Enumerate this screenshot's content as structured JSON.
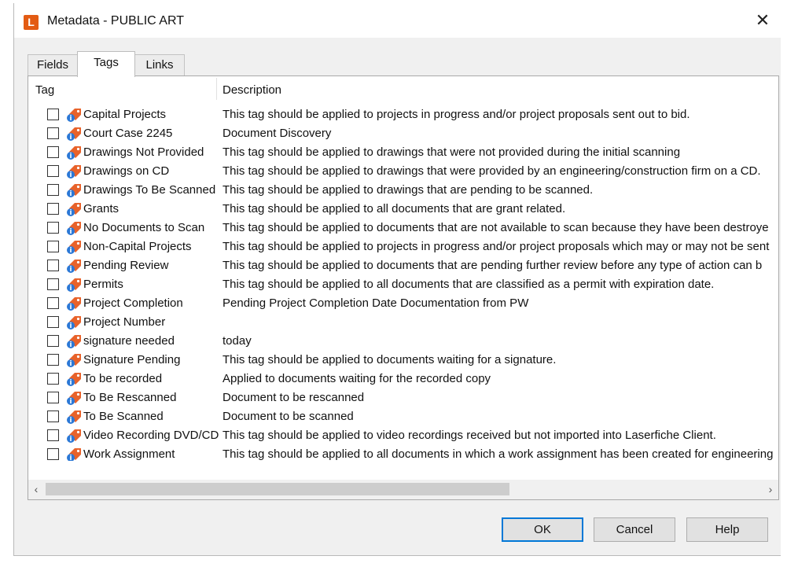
{
  "window": {
    "logo_letter": "L",
    "title": "Metadata - PUBLIC ART",
    "close_glyph": "✕"
  },
  "tabs": [
    {
      "label": "Fields",
      "active": false
    },
    {
      "label": "Tags",
      "active": true
    },
    {
      "label": "Links",
      "active": false
    }
  ],
  "columns": {
    "tag": "Tag",
    "description": "Description"
  },
  "tags": [
    {
      "name": "Capital Projects",
      "description": "This tag should be applied to projects in progress and/or project proposals sent out to bid.",
      "checked": false
    },
    {
      "name": "Court Case 2245",
      "description": "Document Discovery",
      "checked": false
    },
    {
      "name": "Drawings Not Provided",
      "description": "This tag should be applied to drawings that were not provided during the initial scanning",
      "checked": false
    },
    {
      "name": "Drawings on CD",
      "description": "This tag should be applied to drawings that were provided by an engineering/construction firm on a CD.",
      "checked": false
    },
    {
      "name": "Drawings To Be Scanned",
      "description": "This tag should be applied to drawings that are pending to be scanned.",
      "checked": false
    },
    {
      "name": "Grants",
      "description": "This tag should be applied to all documents that are grant related.",
      "checked": false
    },
    {
      "name": "No Documents to Scan",
      "description": "This tag should be applied to documents that are not available to scan because they have been destroye",
      "checked": false
    },
    {
      "name": "Non-Capital Projects",
      "description": "This tag should be applied to projects in progress and/or project proposals which may or may not be sent",
      "checked": false
    },
    {
      "name": "Pending Review",
      "description": "This tag should be applied to documents that are pending further review before any type of action can b",
      "checked": false
    },
    {
      "name": "Permits",
      "description": "This tag should be applied to all documents that are classified as a permit with expiration date.",
      "checked": false
    },
    {
      "name": "Project Completion",
      "description": "Pending Project Completion Date Documentation from PW",
      "checked": false
    },
    {
      "name": "Project Number",
      "description": "",
      "checked": false
    },
    {
      "name": "signature needed",
      "description": "today",
      "checked": false
    },
    {
      "name": "Signature Pending",
      "description": "This tag should be applied to documents waiting for a signature.",
      "checked": false
    },
    {
      "name": "To be recorded",
      "description": "Applied to documents waiting for the recorded copy",
      "checked": false
    },
    {
      "name": "To Be Rescanned",
      "description": "Document to be rescanned",
      "checked": false
    },
    {
      "name": "To Be Scanned",
      "description": "Document to be scanned",
      "checked": false
    },
    {
      "name": "Video Recording DVD/CD",
      "description": "This tag should be applied to video recordings received but not imported into Laserfiche Client.",
      "checked": false
    },
    {
      "name": "Work Assignment",
      "description": "This tag should be applied to all documents in which a work assignment has been created for engineering",
      "checked": false
    }
  ],
  "scrollbar": {
    "left_arrow": "‹",
    "right_arrow": "›"
  },
  "buttons": {
    "ok": "OK",
    "cancel": "Cancel",
    "help": "Help"
  },
  "colors": {
    "logo": "#e35b13",
    "tag_icon": "#e8622a",
    "tag_icon_badge": "#2b78d6",
    "default_button_border": "#0078d7"
  }
}
